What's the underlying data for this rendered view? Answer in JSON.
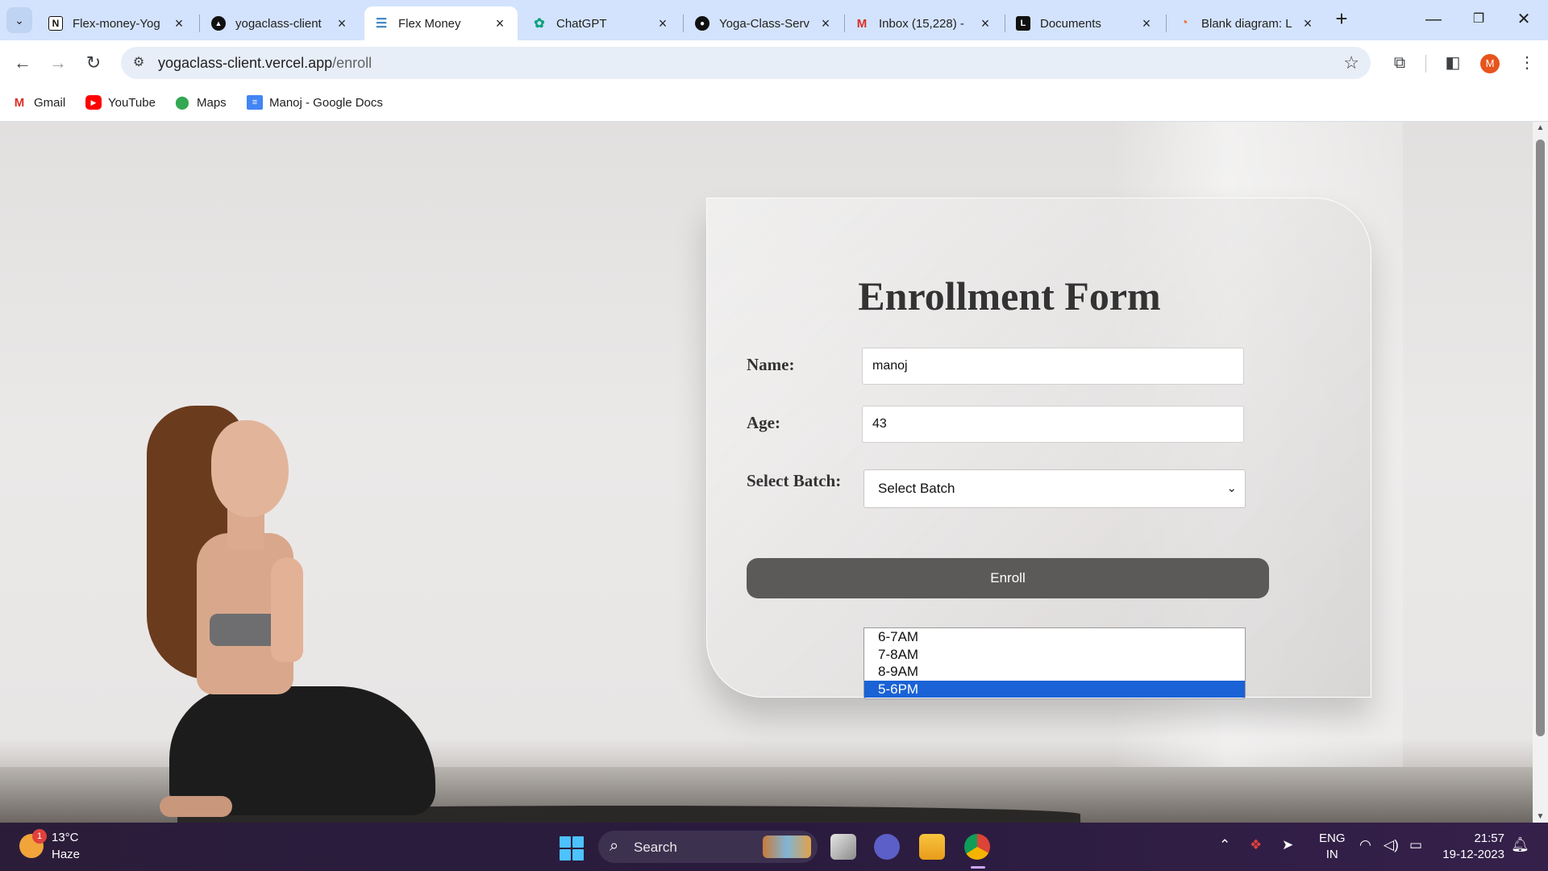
{
  "browser": {
    "tabs": [
      {
        "title": "Flex-money-Yog",
        "active": false
      },
      {
        "title": "yogaclass-client",
        "active": false
      },
      {
        "title": "Flex Money",
        "active": true
      },
      {
        "title": "ChatGPT",
        "active": false
      },
      {
        "title": "Yoga-Class-Serv",
        "active": false
      },
      {
        "title": "Inbox (15,228) -",
        "active": false
      },
      {
        "title": "Documents",
        "active": false
      },
      {
        "title": "Blank diagram: L",
        "active": false
      }
    ],
    "url_host": "yogaclass-client.vercel.app",
    "url_path": "/enroll",
    "bookmarks": [
      "Gmail",
      "YouTube",
      "Maps",
      "Manoj - Google Docs"
    ],
    "profile_initial": "M",
    "colors": {
      "tabstrip": "#d3e3fd",
      "omnibox": "#e8eef7"
    }
  },
  "form": {
    "title": "Enrollment Form",
    "name_label": "Name:",
    "name_value": "manoj",
    "age_label": "Age:",
    "age_value": "43",
    "batch_label": "Select Batch:",
    "batch_selected": "Select Batch",
    "batch_options": [
      "6-7AM",
      "7-8AM",
      "8-9AM",
      "5-6PM"
    ],
    "highlighted_option": "5-6PM",
    "submit_label": "Enroll",
    "colors": {
      "button": "#5b5a59",
      "highlight": "#1a62d5"
    }
  },
  "taskbar": {
    "weather_temp": "13°C",
    "weather_condition": "Haze",
    "weather_badge": "1",
    "search_label": "Search",
    "lang_line1": "ENG",
    "lang_line2": "IN",
    "time": "21:57",
    "date": "19-12-2023"
  }
}
